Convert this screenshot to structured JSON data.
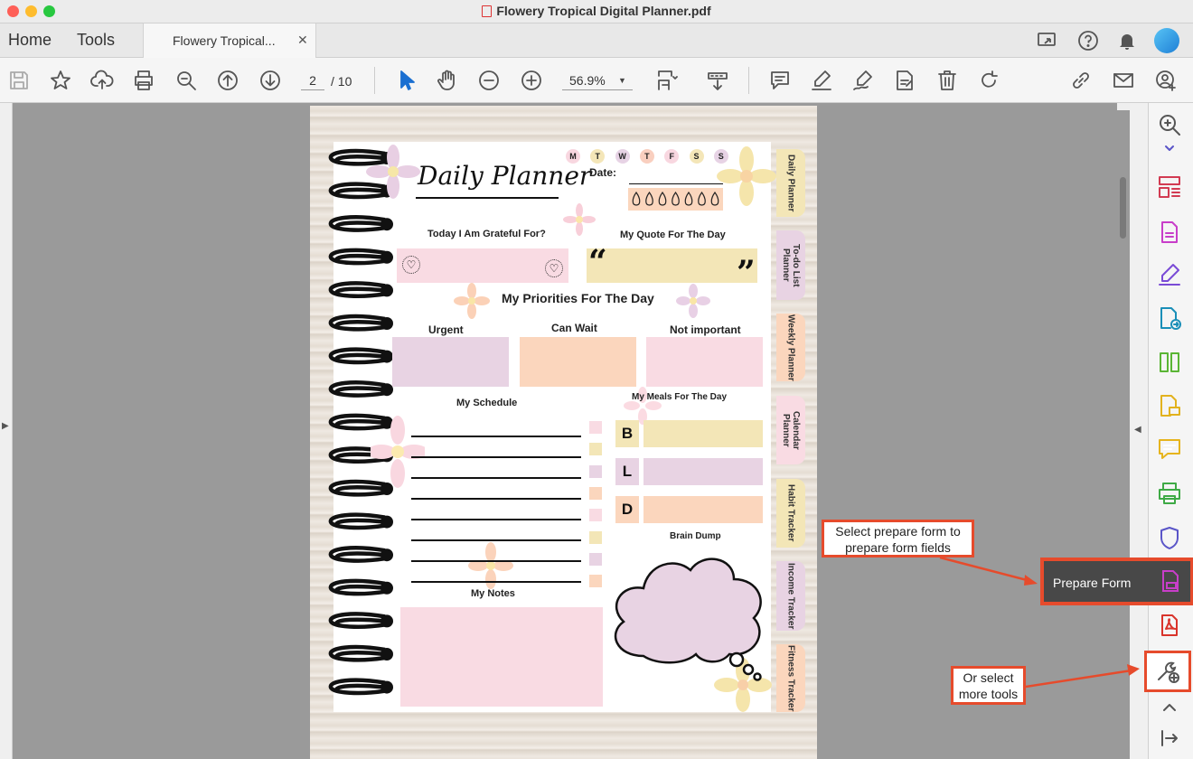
{
  "window": {
    "title": "Flowery Tropical Digital Planner.pdf"
  },
  "tabs": {
    "home": "Home",
    "tools": "Tools",
    "document": "Flowery Tropical..."
  },
  "toolbar": {
    "current_page": "2",
    "total_pages": "/ 10",
    "zoom": "56.9%"
  },
  "planner": {
    "title": "Daily Planner",
    "days": [
      "M",
      "T",
      "W",
      "T",
      "F",
      "S",
      "S"
    ],
    "day_colors": [
      "#f8d7e0",
      "#f4e6b8",
      "#e7d3e5",
      "#f9cfbf",
      "#f8d7e0",
      "#f4e6b8",
      "#e7d3e5"
    ],
    "date_label": "Date:",
    "grateful": "Today I Am Grateful For?",
    "quote": "My Quote For The Day",
    "priorities": "My Priorities For The Day",
    "urgent": "Urgent",
    "can_wait": "Can Wait",
    "not_important": "Not important",
    "schedule": "My Schedule",
    "meals": "My Meals For The Day",
    "meal_letters": [
      "B",
      "L",
      "D"
    ],
    "brain_dump": "Brain Dump",
    "notes": "My Notes",
    "side_tabs": [
      "Daily Planner",
      "To-do List Planner",
      "Weekly Planner",
      "Calendar Planner",
      "Habit Tracker",
      "Income Tracker",
      "Fitness Tracker"
    ]
  },
  "tooltip": {
    "label": "Prepare Form"
  },
  "annotations": {
    "prepare_form": "Select prepare form to prepare form fields",
    "more_tools": "Or select more tools"
  },
  "colors": {
    "pink": "#f9dbe3",
    "purple": "#e8d3e3",
    "peach": "#fbd6bd",
    "yellow": "#f3e6b7",
    "accent_red": "#e64b2c",
    "prepare_form_icon": "#c83ec9"
  }
}
